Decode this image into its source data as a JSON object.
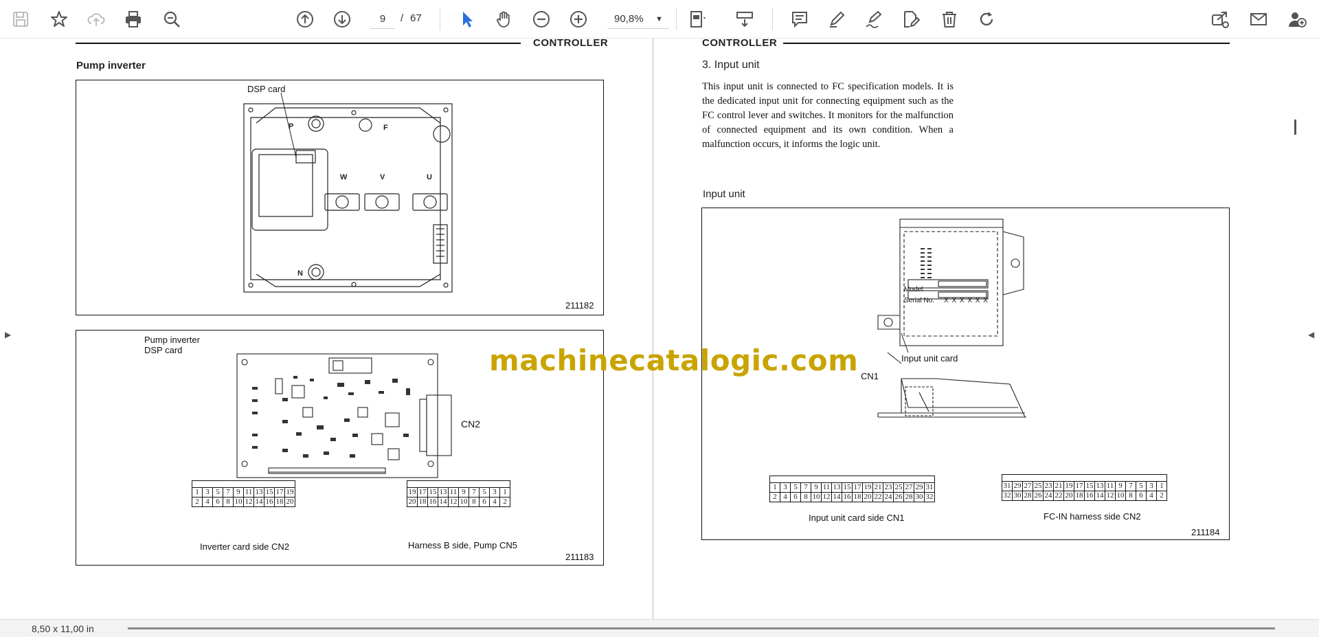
{
  "toolbar": {
    "page_current": "9",
    "page_separator": "/",
    "page_total": "67",
    "zoom": "90,8%",
    "icons": [
      "save-icon",
      "star-icon",
      "cloud-upload-icon",
      "print-icon",
      "zoom-out-search-icon",
      "page-up-icon",
      "page-down-icon",
      "pointer-icon",
      "hand-icon",
      "zoom-out-icon",
      "zoom-in-icon",
      "fit-page-icon",
      "scroll-mode-icon",
      "comment-icon",
      "pen-icon",
      "sign-icon",
      "edit-pdf-icon",
      "delete-icon",
      "rotate-icon",
      "share-icon",
      "mail-icon",
      "add-user-icon"
    ],
    "accent_color": "#2a6ee0"
  },
  "left_page": {
    "header": "CONTROLLER",
    "section_title": "Pump inverter",
    "figure1": {
      "label_dsp": "DSP card",
      "number": "211182",
      "letters": [
        "P",
        "F",
        "W",
        "V",
        "U",
        "N"
      ]
    },
    "figure2": {
      "title_line1": "Pump inverter",
      "title_line2": "DSP card",
      "cn_label": "CN2",
      "number": "211183",
      "table1": {
        "caption": "Inverter card side CN2",
        "row1": [
          "1",
          "3",
          "5",
          "7",
          "9",
          "11",
          "13",
          "15",
          "17",
          "19"
        ],
        "row2": [
          "2",
          "4",
          "6",
          "8",
          "10",
          "12",
          "14",
          "16",
          "18",
          "20"
        ]
      },
      "table2": {
        "caption": "Harness B side, Pump CN5",
        "row1": [
          "19",
          "17",
          "15",
          "13",
          "11",
          "9",
          "7",
          "5",
          "3",
          "1"
        ],
        "row2": [
          "20",
          "18",
          "16",
          "14",
          "12",
          "10",
          "8",
          "6",
          "4",
          "2"
        ]
      }
    }
  },
  "right_page": {
    "header": "CONTROLLER",
    "section_title": "3.  Input unit",
    "body": "This input unit is connected to FC specification models. It is the dedicated input unit for connecting equipment such as the FC control lever and switches. It monitors for the malfunction of connected equipment and its own condition. When a malfunction occurs, it informs the logic unit.",
    "figure_title": "Input unit",
    "figure": {
      "model_label": "Model",
      "serial_label": "Serial No.",
      "serial_value": "X X X X X X",
      "card_label": "Input unit card",
      "cn1_label": "CN1",
      "number": "211184",
      "table1": {
        "caption": "Input unit card side CN1",
        "row1": [
          "1",
          "3",
          "5",
          "7",
          "9",
          "11",
          "13",
          "15",
          "17",
          "19",
          "21",
          "23",
          "25",
          "27",
          "29",
          "31"
        ],
        "row2": [
          "2",
          "4",
          "6",
          "8",
          "10",
          "12",
          "14",
          "16",
          "18",
          "20",
          "22",
          "24",
          "26",
          "28",
          "30",
          "32"
        ]
      },
      "table2": {
        "caption": "FC-IN harness side CN2",
        "row1": [
          "31",
          "29",
          "27",
          "25",
          "23",
          "21",
          "19",
          "17",
          "15",
          "13",
          "11",
          "9",
          "7",
          "5",
          "3",
          "1"
        ],
        "row2": [
          "32",
          "30",
          "28",
          "26",
          "24",
          "22",
          "20",
          "18",
          "16",
          "14",
          "12",
          "10",
          "8",
          "6",
          "4",
          "2"
        ]
      }
    }
  },
  "watermark": "machinecatalogic.com",
  "statusbar": {
    "page_size": "8,50 x 11,00 in"
  }
}
